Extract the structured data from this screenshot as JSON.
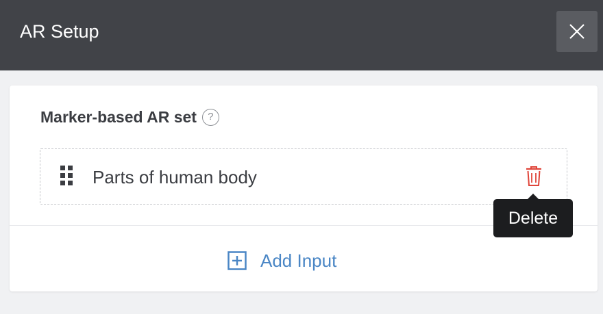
{
  "header": {
    "title": "AR Setup",
    "close_icon": "close-icon"
  },
  "card": {
    "section_title": "Marker-based AR set",
    "help_icon": "question-circle-icon",
    "help_symbol": "?",
    "items": [
      {
        "label": "Parts of human body",
        "drag_icon": "drag-handle-icon",
        "delete_icon": "trash-icon"
      }
    ],
    "add_input": {
      "label": "Add Input",
      "icon": "plus-square-icon"
    }
  },
  "tooltip": {
    "text": "Delete"
  },
  "colors": {
    "header_bg": "#414348",
    "accent": "#4a86c5",
    "delete": "#e0453a",
    "tooltip_bg": "#1c1d1f"
  }
}
